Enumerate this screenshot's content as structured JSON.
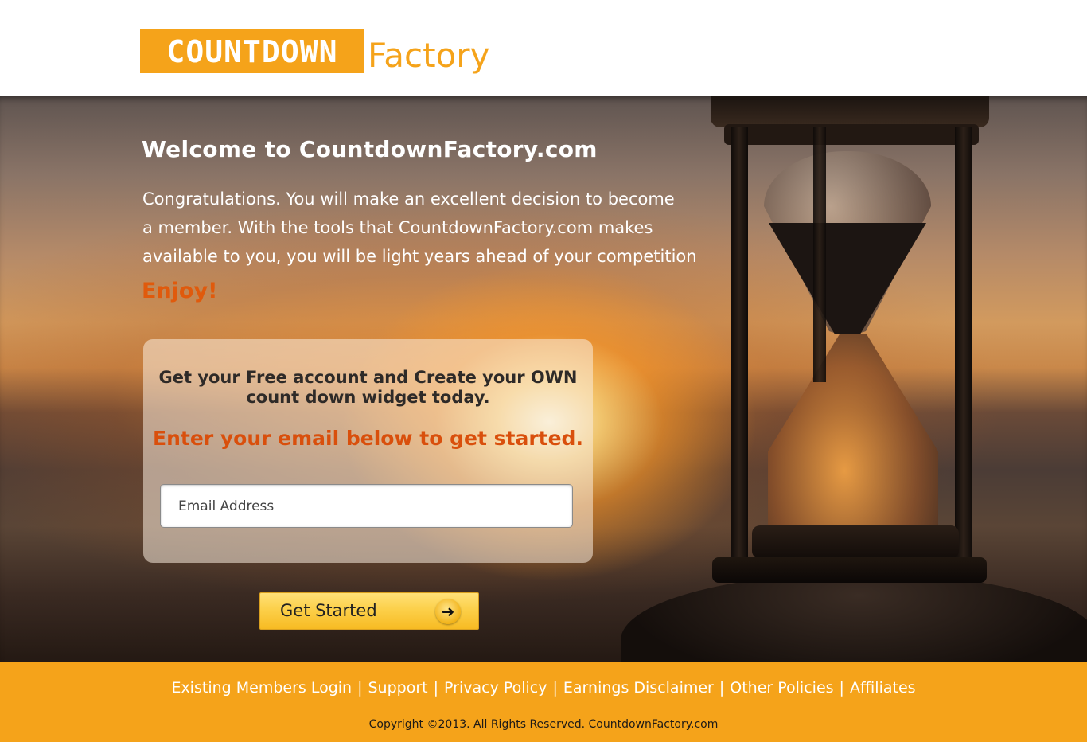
{
  "brand": {
    "logo_box_text": "COUNTDOWN",
    "logo_word": "Factory",
    "color": "#f5a31a"
  },
  "hero": {
    "welcome": "Welcome to CountdownFactory.com",
    "intro_lines": [
      "Congratulations. You will make an excellent decision to become",
      "a member. With the tools that CountdownFactory.com makes",
      "available to you, you will be light years ahead of your competition"
    ],
    "enjoy": "Enjoy!"
  },
  "signup": {
    "title_line1": "Get your Free account and Create your OWN",
    "title_line2": "count down widget today.",
    "subtitle": "Enter your email below to get started.",
    "email_placeholder": "Email Address",
    "button_label": "Get Started",
    "button_icon": "arrow-right-icon"
  },
  "footer": {
    "links": [
      "Existing Members Login",
      "Support",
      "Privacy Policy",
      "Earnings Disclaimer",
      "Other Policies",
      "Affiliates"
    ],
    "separator": "|",
    "copyright": "Copyright ©2013. All Rights Reserved. CountdownFactory.com"
  },
  "colors": {
    "accent_orange": "#e05a0c",
    "footer_bg": "#f5a31a",
    "button_gold": "#fcd04a"
  }
}
